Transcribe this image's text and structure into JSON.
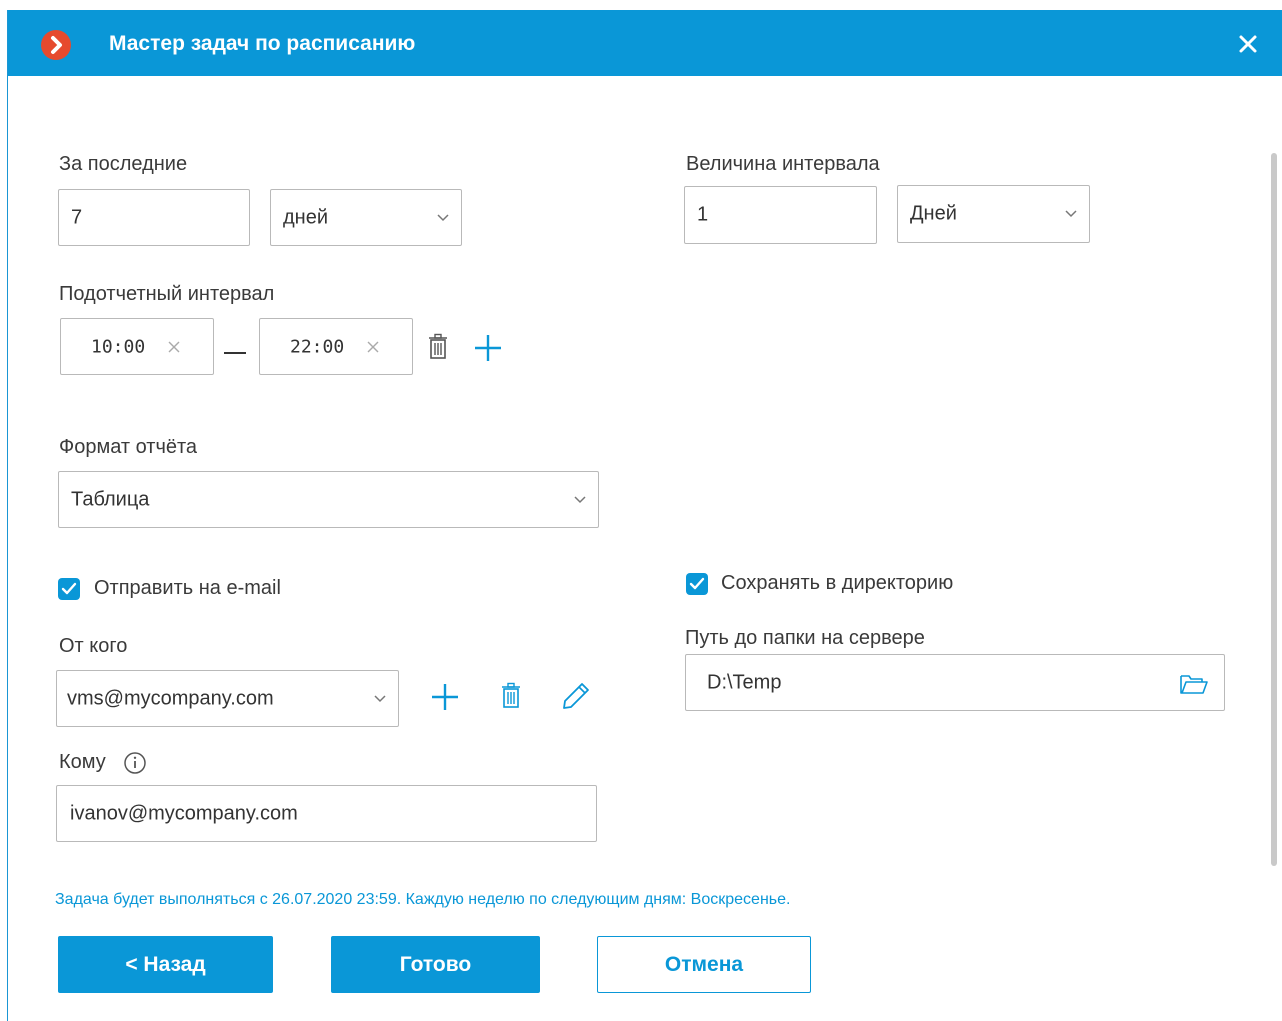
{
  "window": {
    "title": "Мастер задач по расписанию"
  },
  "period": {
    "label": "За последние",
    "value": "7",
    "unit": "дней"
  },
  "interval": {
    "label": "Величина интервала",
    "value": "1",
    "unit": "Дней"
  },
  "reporting_interval": {
    "label": "Подотчетный интервал",
    "start": "10:00",
    "end": "22:00"
  },
  "report_format": {
    "label": "Формат отчёта",
    "value": "Таблица"
  },
  "email": {
    "checkbox_label": "Отправить на e-mail",
    "checked": true,
    "from_label": "От кого",
    "from_value": "vms@mycompany.com",
    "to_label": "Кому",
    "to_value": "ivanov@mycompany.com"
  },
  "directory": {
    "checkbox_label": "Сохранять в директорию",
    "checked": true,
    "path_label": "Путь до папки на сервере",
    "path_value": "D:\\Temp"
  },
  "schedule_info": "Задача будет выполняться с 26.07.2020 23:59. Каждую неделю по следующим дням: Воскресенье.",
  "buttons": {
    "back": "< Назад",
    "done": "Готово",
    "cancel": "Отмена"
  },
  "colors": {
    "accent": "#0a97d7",
    "logo": "#e64a2e"
  }
}
